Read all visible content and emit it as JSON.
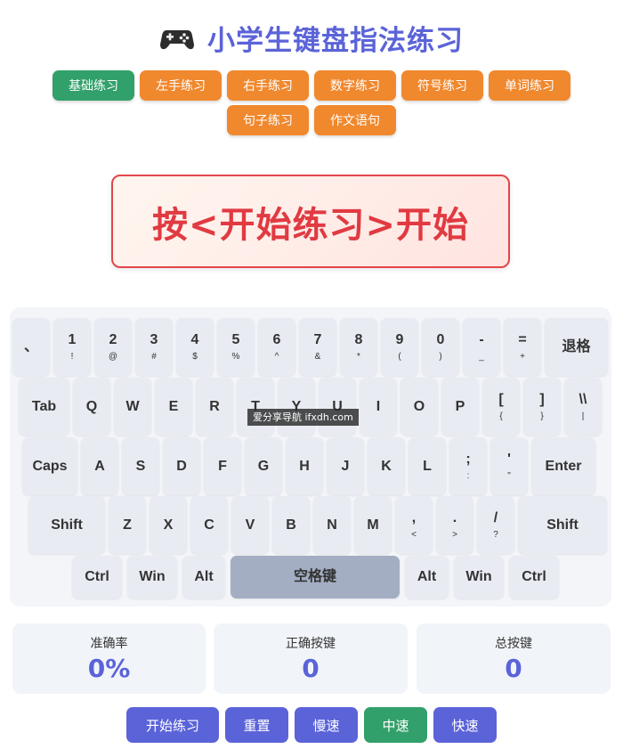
{
  "header": {
    "title": "小学生键盘指法练习",
    "icon": "gamepad-icon"
  },
  "modes": [
    "基础练习",
    "左手练习",
    "右手练习",
    "数字练习",
    "符号练习",
    "单词练习",
    "句子练习",
    "作文语句"
  ],
  "active_mode": "基础练习",
  "prompt": "按<开始练习>开始",
  "keyboard": {
    "rows": [
      [
        [
          "、",
          ""
        ],
        [
          "1",
          "!"
        ],
        [
          "2",
          "@"
        ],
        [
          "3",
          "#"
        ],
        [
          "4",
          "$"
        ],
        [
          "5",
          "%"
        ],
        [
          "6",
          "^"
        ],
        [
          "7",
          "&"
        ],
        [
          "8",
          "*"
        ],
        [
          "9",
          "("
        ],
        [
          "0",
          ")"
        ],
        [
          "-",
          "_"
        ],
        [
          "=",
          "+"
        ],
        [
          "退格",
          ""
        ]
      ],
      [
        [
          "Tab",
          ""
        ],
        [
          "Q",
          ""
        ],
        [
          "W",
          ""
        ],
        [
          "E",
          ""
        ],
        [
          "R",
          ""
        ],
        [
          "T",
          ""
        ],
        [
          "Y",
          ""
        ],
        [
          "U",
          ""
        ],
        [
          "I",
          ""
        ],
        [
          "O",
          ""
        ],
        [
          "P",
          ""
        ],
        [
          "[",
          "{"
        ],
        [
          "]",
          "}"
        ],
        [
          "\\\\",
          "|"
        ]
      ],
      [
        [
          "Caps",
          ""
        ],
        [
          "A",
          ""
        ],
        [
          "S",
          ""
        ],
        [
          "D",
          ""
        ],
        [
          "F",
          ""
        ],
        [
          "G",
          ""
        ],
        [
          "H",
          ""
        ],
        [
          "J",
          ""
        ],
        [
          "K",
          ""
        ],
        [
          "L",
          ""
        ],
        [
          ";",
          ":"
        ],
        [
          "'",
          "\""
        ],
        [
          "Enter",
          ""
        ]
      ],
      [
        [
          "Shift",
          ""
        ],
        [
          "Z",
          ""
        ],
        [
          "X",
          ""
        ],
        [
          "C",
          ""
        ],
        [
          "V",
          ""
        ],
        [
          "B",
          ""
        ],
        [
          "N",
          ""
        ],
        [
          "M",
          ""
        ],
        [
          ",",
          "<"
        ],
        [
          ".",
          ">"
        ],
        [
          "/",
          "?"
        ],
        [
          "Shift",
          ""
        ]
      ],
      [
        [
          "Ctrl",
          ""
        ],
        [
          "Win",
          ""
        ],
        [
          "Alt",
          ""
        ],
        [
          "空格键",
          ""
        ],
        [
          "Alt",
          ""
        ],
        [
          "Win",
          ""
        ],
        [
          "Ctrl",
          ""
        ]
      ]
    ]
  },
  "watermark": "爱分享导航 ifxdh.com",
  "stats": [
    {
      "label": "准确率",
      "value": "0%"
    },
    {
      "label": "正确按键",
      "value": "0"
    },
    {
      "label": "总按键",
      "value": "0"
    }
  ],
  "controls": [
    "开始练习",
    "重置",
    "慢速",
    "中速",
    "快速"
  ],
  "active_speed": "中速",
  "colors": {
    "accent": "#5b63d8",
    "orange": "#f0882e",
    "green": "#32a06a",
    "red": "#e13a42"
  }
}
